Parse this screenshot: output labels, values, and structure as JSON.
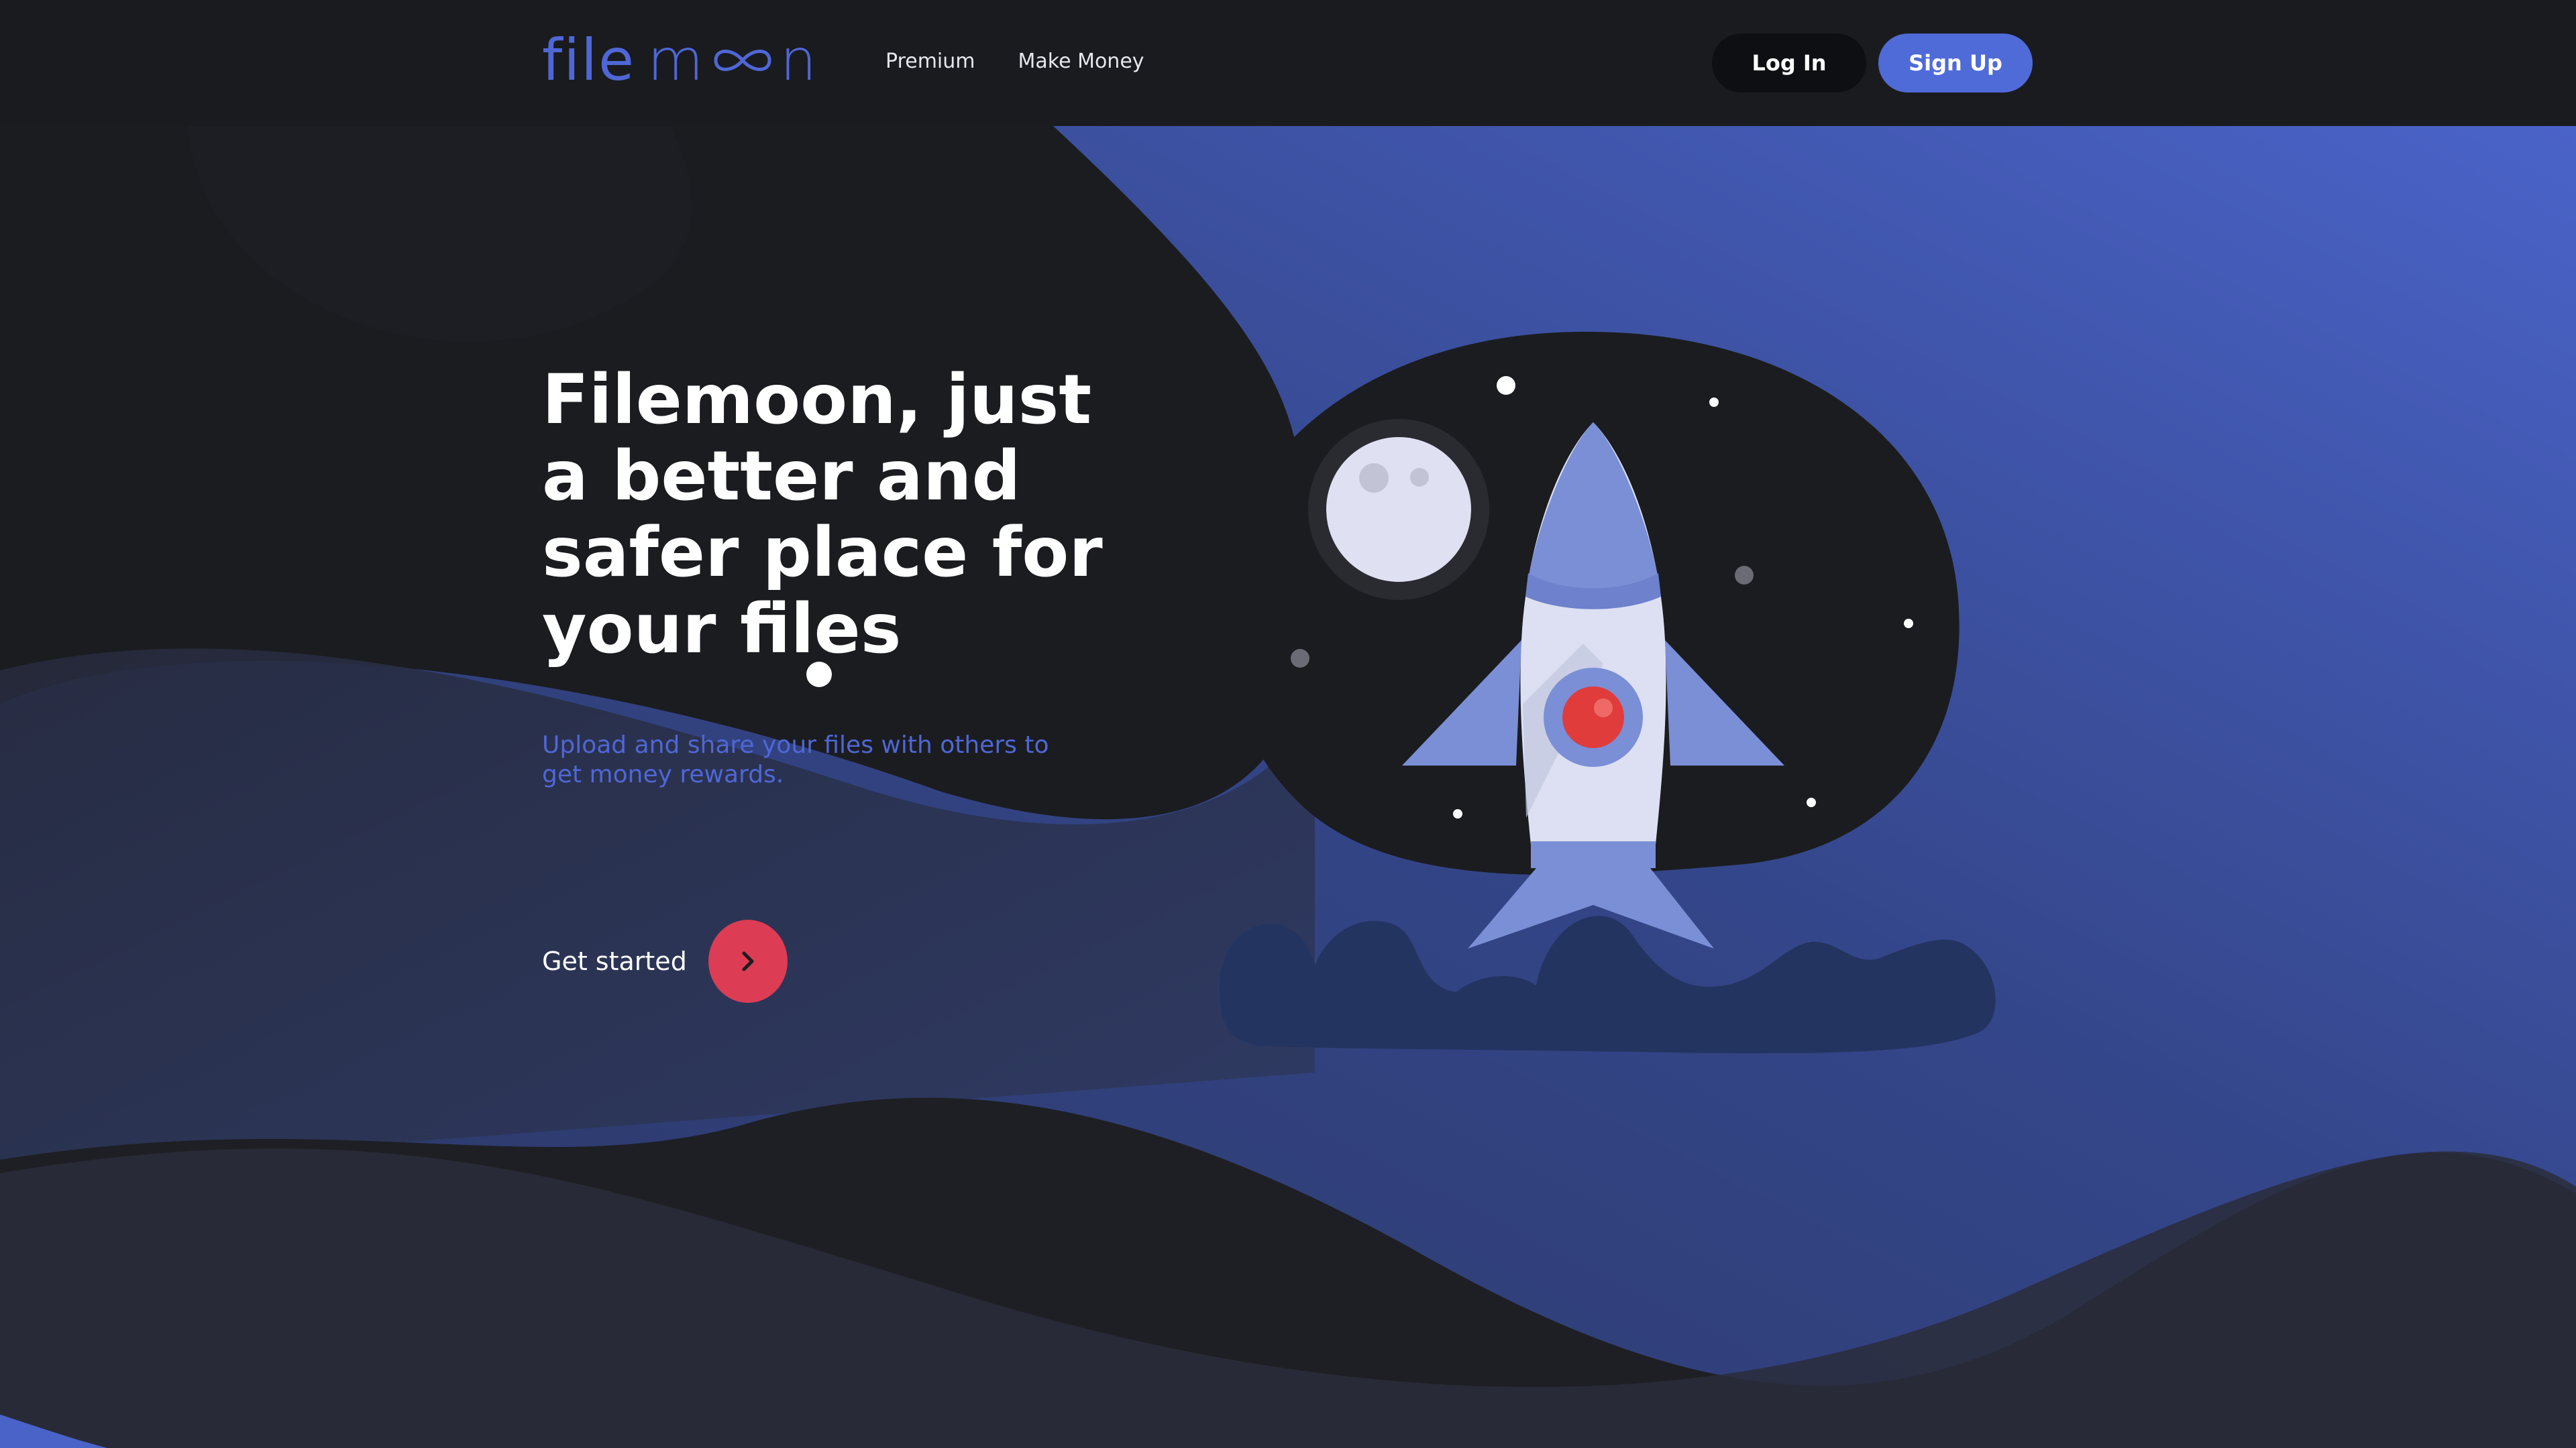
{
  "header": {
    "logo": {
      "text_a": "file",
      "text_b": "m",
      "text_c": "n",
      "icon": "infinity-icon"
    },
    "nav": [
      {
        "label": "Premium"
      },
      {
        "label": "Make Money"
      }
    ],
    "login_label": "Log In",
    "signup_label": "Sign Up"
  },
  "hero": {
    "title": "Filemoon, just a better and safer place for your files",
    "subtitle": "Upload and share your files with others to get money rewards.",
    "cta_label": "Get started",
    "cta_icon": "chevron-right-icon"
  },
  "illustration": {
    "name": "rocket-launch-illustration",
    "icons": [
      "moon-icon",
      "rocket-icon",
      "star-icon",
      "cloud-smoke-icon"
    ]
  },
  "colors": {
    "background": "#1b1c20",
    "accent_blue": "#4f6bd8",
    "cta_red": "#dc3c54",
    "rocket_body": "#dde0f2",
    "rocket_fin": "#7b8fd6"
  }
}
